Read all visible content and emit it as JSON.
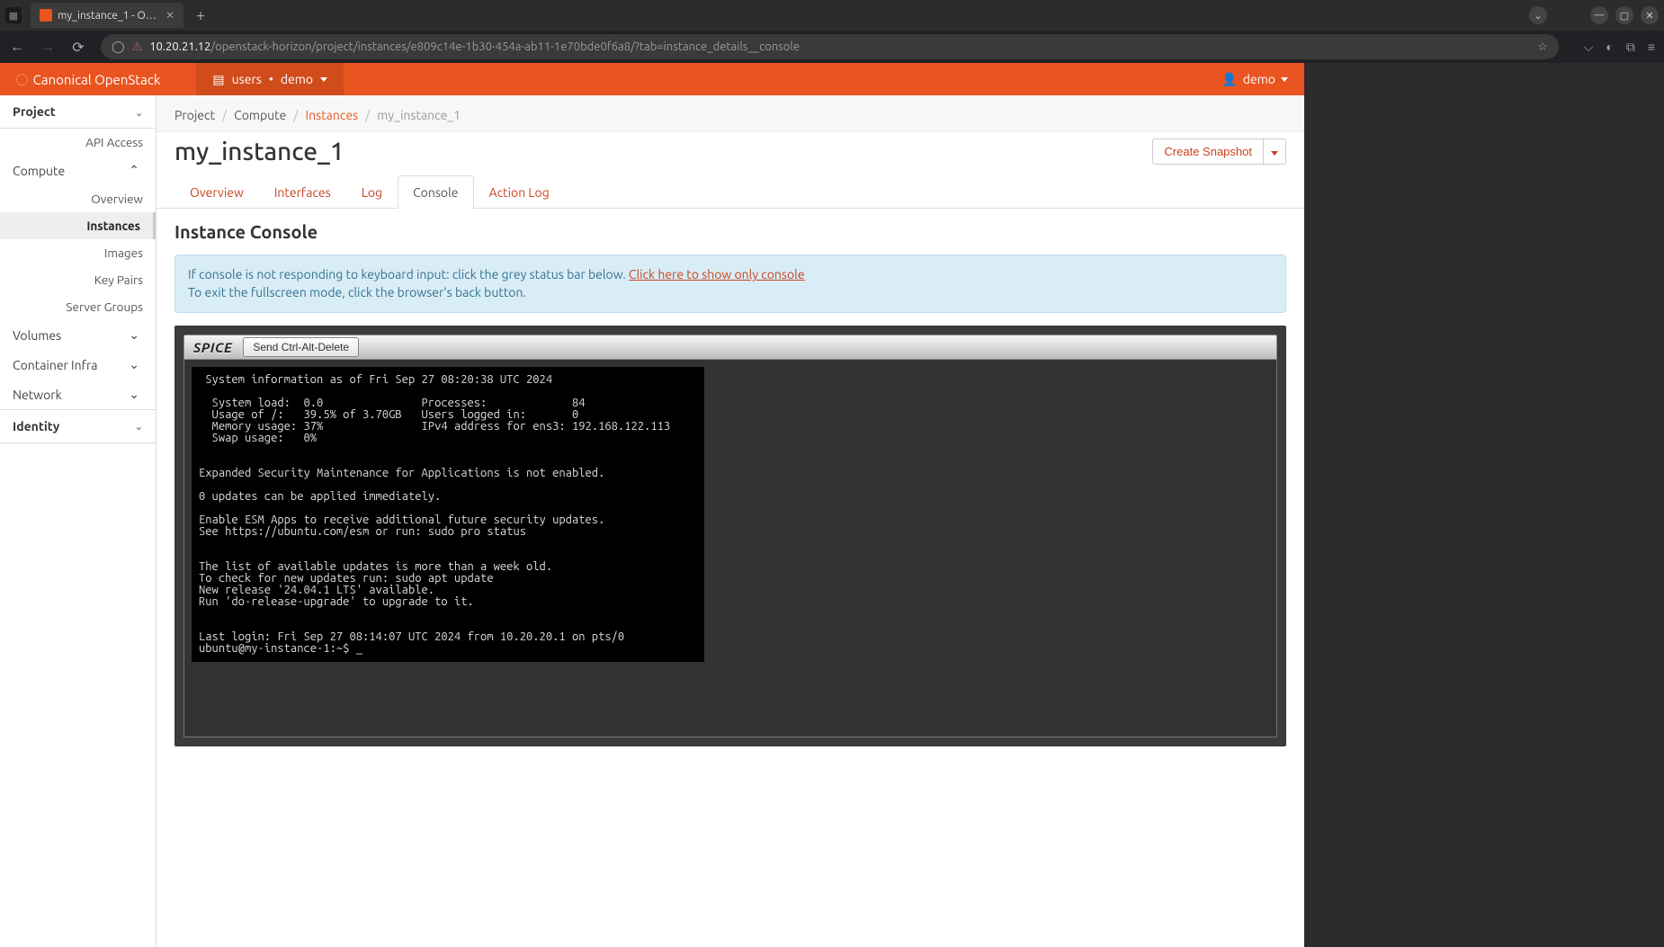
{
  "browser": {
    "tab_title": "my_instance_1 - OpenSt…",
    "url_host": "10.20.21.12",
    "url_path": "/openstack-horizon/project/instances/e809c14e-1b30-454a-ab11-1e70bde0f6a8/?tab=instance_details__console"
  },
  "topbar": {
    "brand": "Canonical OpenStack",
    "domain_label": "users",
    "project_label": "demo",
    "user_label": "demo"
  },
  "sidebar": {
    "project": "Project",
    "api_access": "API Access",
    "compute": "Compute",
    "compute_items": {
      "overview": "Overview",
      "instances": "Instances",
      "images": "Images",
      "key_pairs": "Key Pairs",
      "server_groups": "Server Groups"
    },
    "volumes": "Volumes",
    "container_infra": "Container Infra",
    "network": "Network",
    "identity": "Identity"
  },
  "breadcrumb": {
    "project": "Project",
    "compute": "Compute",
    "instances": "Instances",
    "here": "my_instance_1"
  },
  "page": {
    "title": "my_instance_1",
    "create_snapshot": "Create Snapshot"
  },
  "tabs": {
    "overview": "Overview",
    "interfaces": "Interfaces",
    "log": "Log",
    "console": "Console",
    "action_log": "Action Log"
  },
  "console": {
    "section_title": "Instance Console",
    "info_line1_prefix": "If console is not responding to keyboard input: click the grey status bar below. ",
    "info_link": "Click here to show only console",
    "info_line2": "To exit the fullscreen mode, click the browser's back button.",
    "spice_label": "SPICE",
    "cad_button": "Send Ctrl-Alt-Delete",
    "terminal_text": " System information as of Fri Sep 27 08:20:38 UTC 2024\n\n  System load:  0.0               Processes:             84\n  Usage of /:   39.5% of 3.70GB   Users logged in:       0\n  Memory usage: 37%               IPv4 address for ens3: 192.168.122.113\n  Swap usage:   0%\n\n\nExpanded Security Maintenance for Applications is not enabled.\n\n0 updates can be applied immediately.\n\nEnable ESM Apps to receive additional future security updates.\nSee https://ubuntu.com/esm or run: sudo pro status\n\n\nThe list of available updates is more than a week old.\nTo check for new updates run: sudo apt update\nNew release '24.04.1 LTS' available.\nRun 'do-release-upgrade' to upgrade to it.\n\n\nLast login: Fri Sep 27 08:14:07 UTC 2024 from 10.20.20.1 on pts/0\nubuntu@my-instance-1:~$ _"
  }
}
